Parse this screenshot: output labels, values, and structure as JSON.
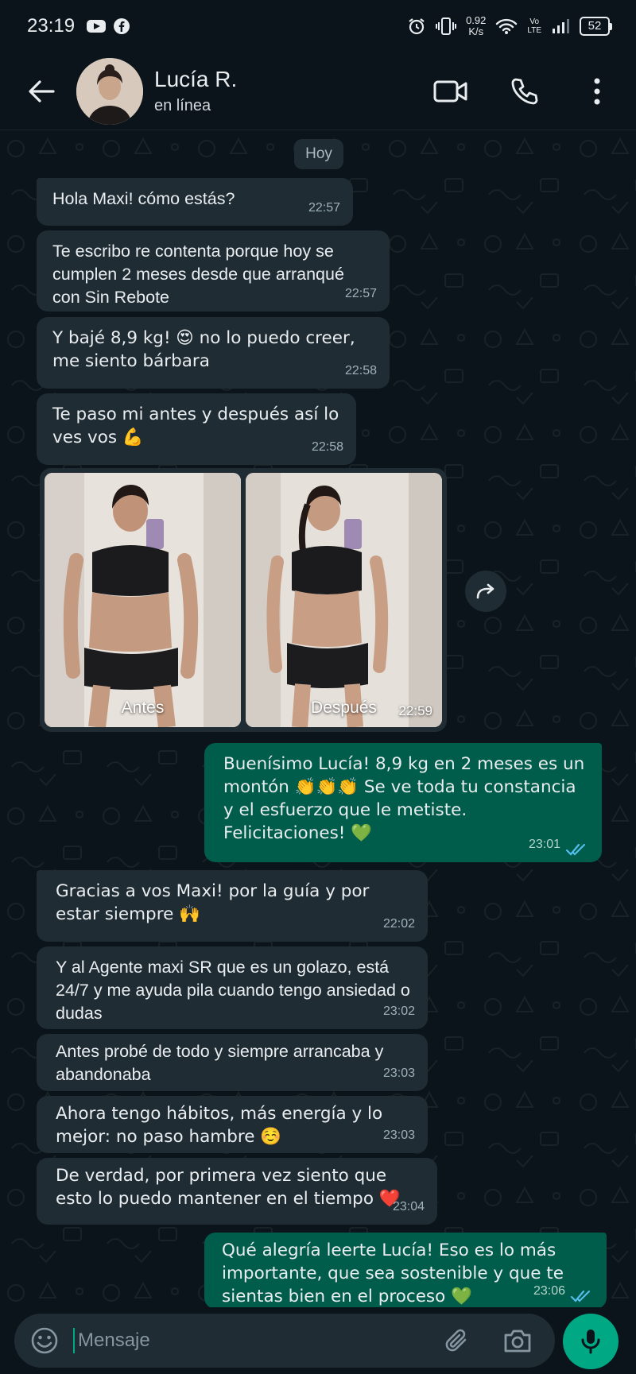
{
  "status_bar": {
    "time": "23:19",
    "net_speed_value": "0.92",
    "net_speed_unit": "K/s",
    "volte_top": "Vo",
    "volte_bottom": "LTE",
    "battery": "52"
  },
  "header": {
    "contact_name": "Lucía R.",
    "contact_status": "en línea"
  },
  "date_chip": "Hoy",
  "messages": [
    {
      "dir": "in",
      "text": "Hola Maxi! cómo estás?",
      "time": "22:57"
    },
    {
      "dir": "in",
      "text": "Te escribo re contenta porque hoy se cumplen 2 meses desde que arranqué con Sin Rebote",
      "time": "22:57"
    },
    {
      "dir": "in",
      "text": "Y bajé 8,9 kg! 😍 no lo puedo creer, me siento bárbara",
      "time": "22:58"
    },
    {
      "dir": "in",
      "text": "Te paso mi antes y después así lo ves vos 💪",
      "time": "22:58"
    },
    {
      "dir": "out",
      "text": "Buenísimo Lucía! 8,9 kg en 2 meses es un montón 👏👏👏 Se ve toda tu constancia y el esfuerzo que le metiste. Felicitaciones! 💚",
      "time": "23:01"
    },
    {
      "dir": "in",
      "text": "Gracias a vos Maxi! por la guía y por estar siempre 🙌",
      "time": "22:02"
    },
    {
      "dir": "in",
      "text": "Y al Agente maxi SR que es un golazo, está 24/7 y me ayuda pila cuando tengo ansiedad o dudas",
      "time": "23:02"
    },
    {
      "dir": "in",
      "text": "Antes probé de todo y siempre arrancaba y abandonaba",
      "time": "23:03"
    },
    {
      "dir": "in",
      "text": "Ahora tengo hábitos, más energía y lo mejor: no paso hambre ☺️",
      "time": "23:03"
    },
    {
      "dir": "in",
      "text": "De verdad, por primera vez siento que esto lo puedo mantener en el tiempo ❤️",
      "time": "23:04"
    },
    {
      "dir": "out",
      "text": "Qué alegría leerte Lucía! Eso es lo más importante, que sea sostenible y que te sientas bien en el proceso 💚",
      "time": "23:06"
    }
  ],
  "photo_message": {
    "caption_left": "Antes",
    "caption_right": "Después",
    "time": "22:59"
  },
  "composer": {
    "placeholder": "Mensaje"
  },
  "colors": {
    "incoming": "#1f2c34",
    "outgoing": "#005c4b",
    "accent": "#00a884",
    "background": "#0b141a",
    "read_ticks": "#53bdeb"
  },
  "icons": [
    "youtube-icon",
    "facebook-icon",
    "alarm-icon",
    "vibrate-icon",
    "wifi-icon",
    "signal-icon",
    "back-arrow-icon",
    "video-call-icon",
    "phone-icon",
    "more-vert-icon",
    "forward-icon",
    "emoji-icon",
    "attach-icon",
    "camera-icon",
    "mic-icon",
    "double-check-icon"
  ]
}
